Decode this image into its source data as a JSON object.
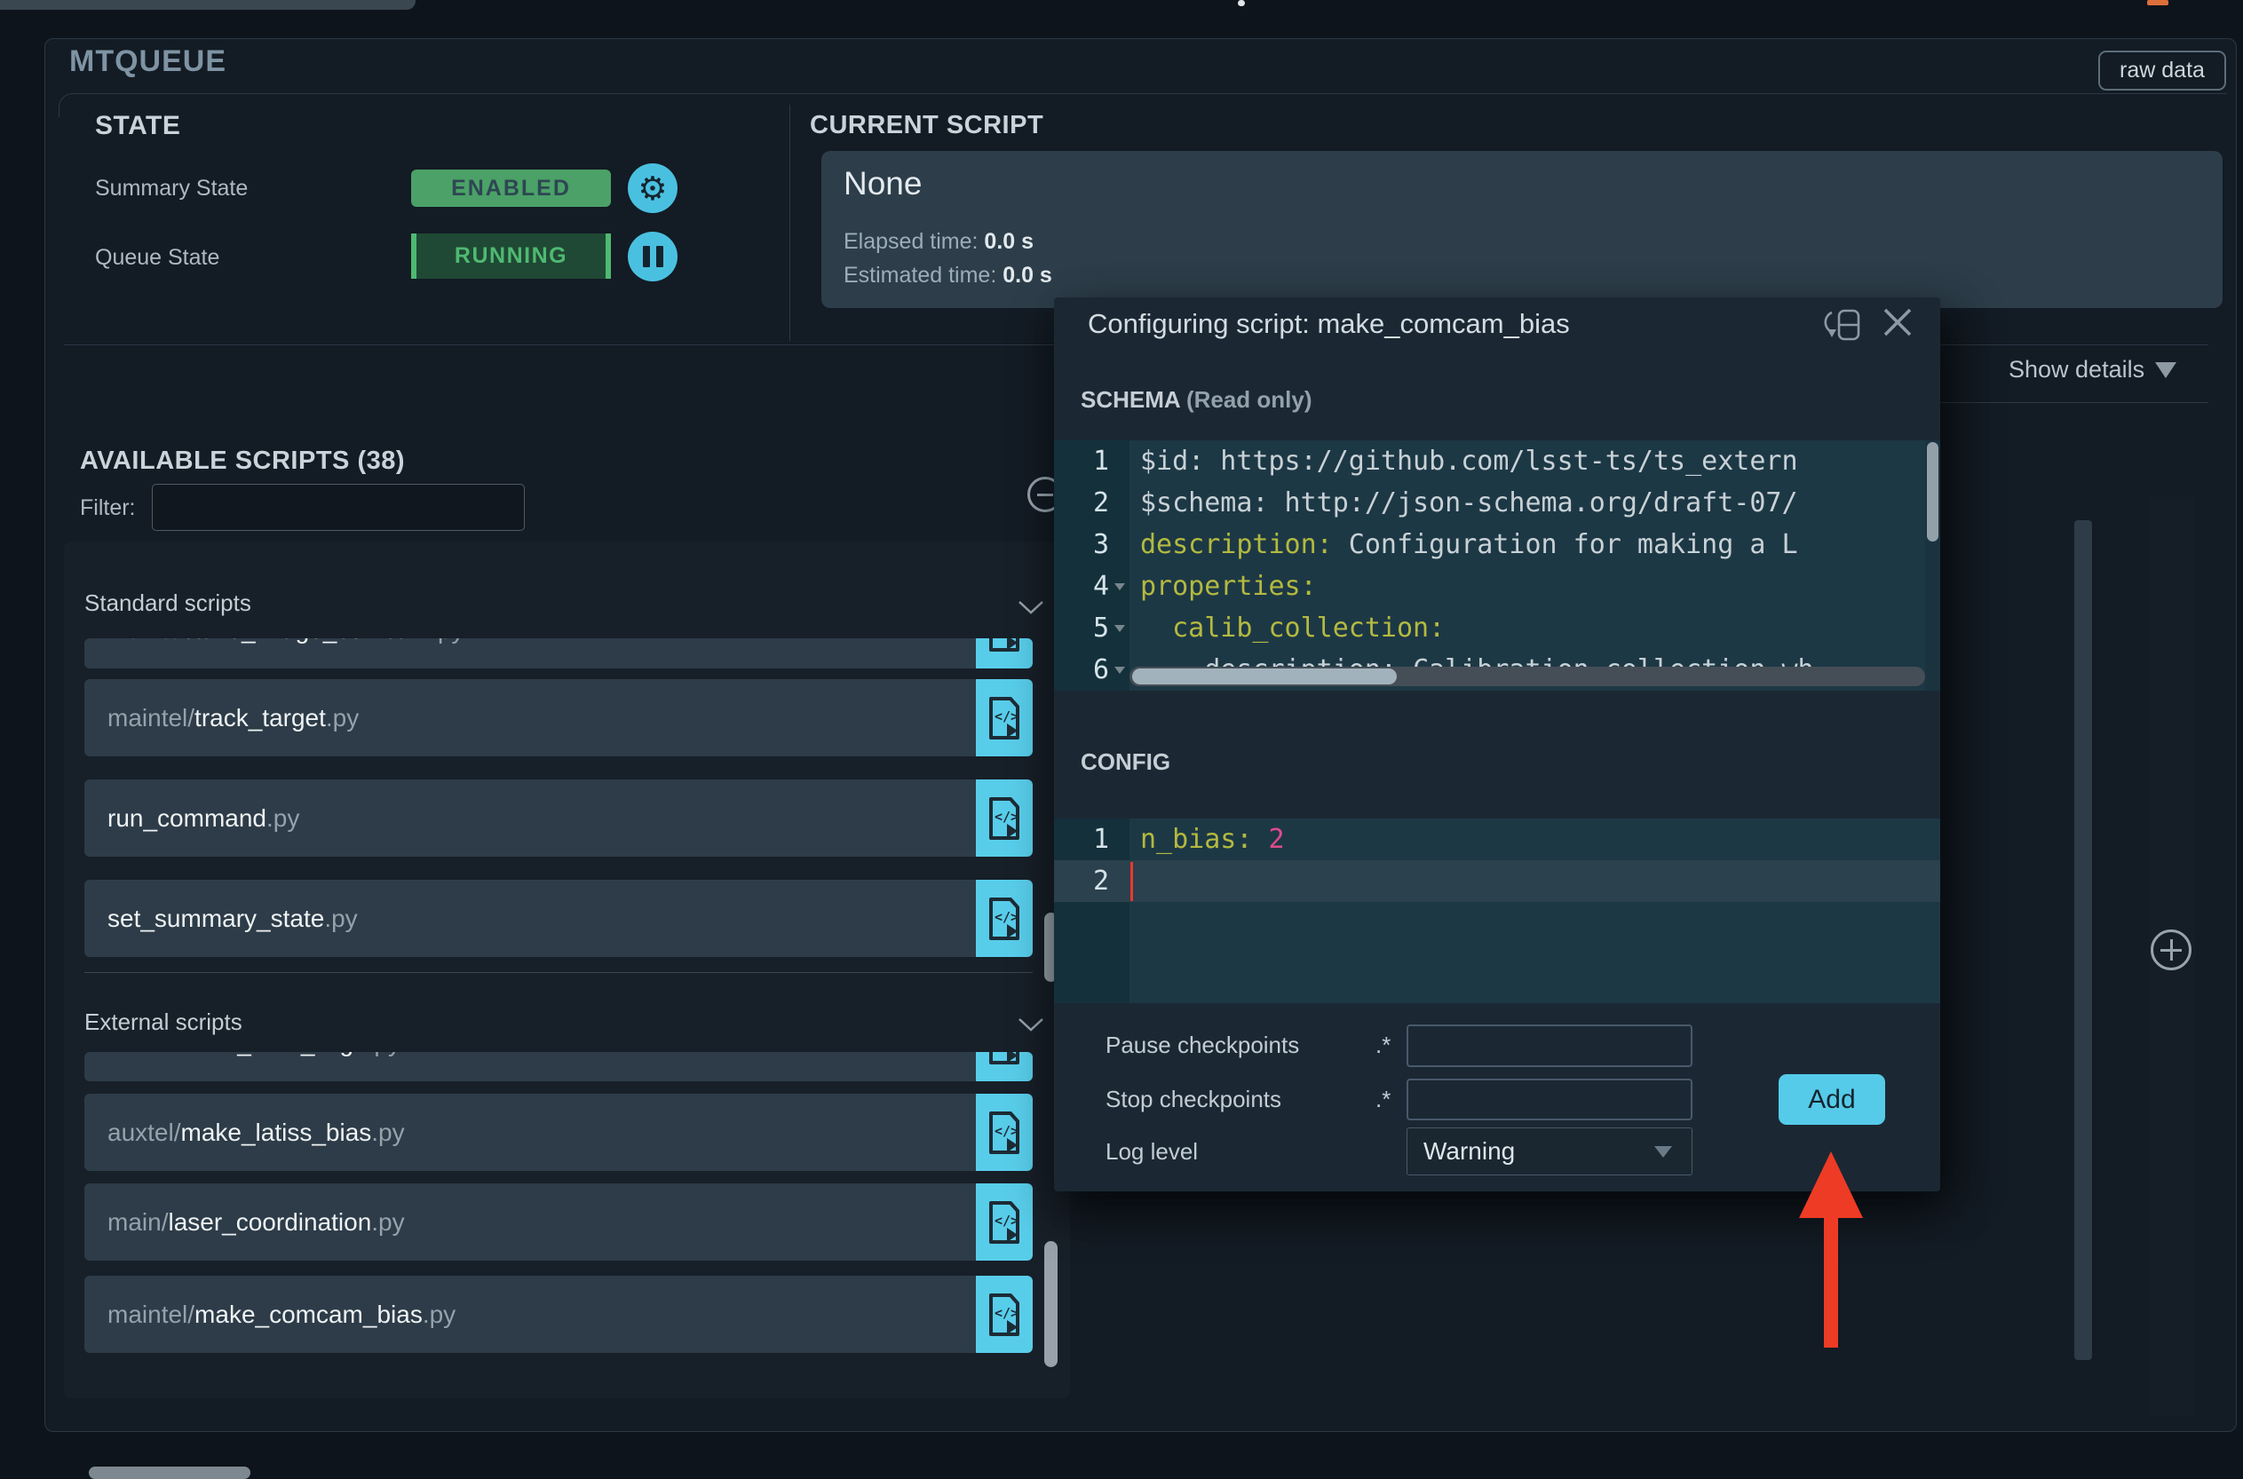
{
  "panel": {
    "title": "MTQUEUE",
    "raw_data_label": "raw data",
    "show_details_label": "Show details"
  },
  "state": {
    "heading": "STATE",
    "summary_label": "Summary State",
    "summary_value": "ENABLED",
    "queue_label": "Queue State",
    "queue_value": "RUNNING"
  },
  "current_script": {
    "heading": "CURRENT SCRIPT",
    "name": "None",
    "elapsed_label": "Elapsed time:",
    "elapsed_value": "0.0 s",
    "estimated_label": "Estimated time:",
    "estimated_value": "0.0 s"
  },
  "available_scripts": {
    "heading": "AVAILABLE SCRIPTS (38)",
    "filter_label": "Filter:",
    "filter_value": "",
    "groups": [
      {
        "label": "Standard scripts",
        "clipped": {
          "prefix": "maintel/",
          "name": "take_image_comcam",
          "ext": ".py"
        },
        "items": [
          {
            "prefix": "maintel/",
            "name": "track_target",
            "ext": ".py"
          },
          {
            "prefix": "",
            "name": "run_command",
            "ext": ".py"
          },
          {
            "prefix": "",
            "name": "set_summary_state",
            "ext": ".py"
          }
        ]
      },
      {
        "label": "External scripts",
        "clipped": {
          "prefix": "auxtel/",
          "name": "latiss_cwfs_align",
          "ext": ".py"
        },
        "items": [
          {
            "prefix": "auxtel/",
            "name": "make_latiss_bias",
            "ext": ".py"
          },
          {
            "prefix": "main/",
            "name": "laser_coordination",
            "ext": ".py"
          },
          {
            "prefix": "maintel/",
            "name": "make_comcam_bias",
            "ext": ".py"
          }
        ]
      }
    ]
  },
  "dialog": {
    "title": "Configuring script: make_comcam_bias",
    "schema_label": "SCHEMA",
    "schema_note": "(Read only)",
    "schema_lines": [
      {
        "n": "1",
        "segs": [
          [
            "plain",
            "$id: https://github.com/lsst-ts/ts_extern"
          ]
        ]
      },
      {
        "n": "2",
        "segs": [
          [
            "plain",
            "$schema: http://json-schema.org/draft-07/"
          ]
        ]
      },
      {
        "n": "3",
        "segs": [
          [
            "key",
            "description:"
          ],
          [
            "plain",
            " Configuration for making a L"
          ]
        ]
      },
      {
        "n": "4",
        "fold": true,
        "segs": [
          [
            "key",
            "properties:"
          ]
        ]
      },
      {
        "n": "5",
        "fold": true,
        "segs": [
          [
            "key",
            "  calib_collection:"
          ]
        ]
      },
      {
        "n": "6",
        "fold": true,
        "segs": [
          [
            "plain",
            "    description: Calibration collection wh"
          ]
        ]
      }
    ],
    "config_label": "CONFIG",
    "config_lines": [
      {
        "n": "1",
        "segs": [
          [
            "key",
            "n_bias:"
          ],
          [
            "plain",
            " "
          ],
          [
            "num",
            "2"
          ]
        ]
      },
      {
        "n": "2",
        "active": true,
        "cursor": true,
        "segs": []
      }
    ],
    "form": {
      "pause_label": "Pause checkpoints",
      "pause_value": ".*",
      "pause_input": "",
      "stop_label": "Stop checkpoints",
      "stop_value": ".*",
      "stop_input": "",
      "log_label": "Log level",
      "log_value": "Warning",
      "add_label": "Add"
    }
  },
  "colors": {
    "accent_cyan": "#4ac0e0",
    "enabled_green": "#4ba167",
    "running_green": "#4fb971",
    "yaml_key": "#b3ba3f",
    "yaml_number": "#de4b8c",
    "annotation_arrow": "#ee3b25"
  }
}
